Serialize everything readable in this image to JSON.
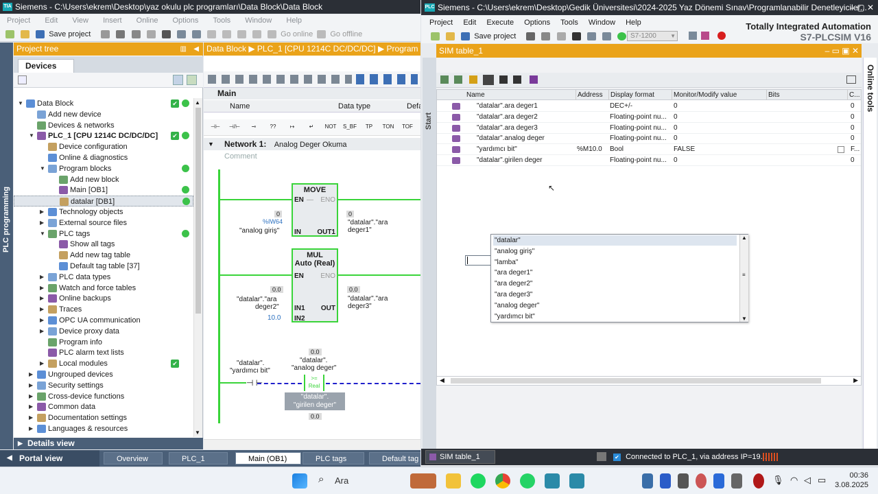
{
  "tia": {
    "title": "Siemens  -  C:\\Users\\ekrem\\Desktop\\yaz okulu plc programları\\Data Block\\Data Block",
    "menu": [
      "Project",
      "Edit",
      "View",
      "Insert",
      "Online",
      "Options",
      "Tools",
      "Window",
      "Help"
    ],
    "toolbar": {
      "save": "Save project",
      "go_online": "Go online",
      "go_offline": "Go offline"
    },
    "sidebar_label": "PLC programming",
    "project_tree": {
      "title": "Project tree",
      "devices_tab": "Devices",
      "items": [
        {
          "label": "Data Block",
          "lvl": 0,
          "arrow": "▼",
          "status": "check-dot"
        },
        {
          "label": "Add new device",
          "lvl": 1,
          "arrow": ""
        },
        {
          "label": "Devices & networks",
          "lvl": 1,
          "arrow": ""
        },
        {
          "label": "PLC_1 [CPU 1214C DC/DC/DC]",
          "lvl": 1,
          "arrow": "▼",
          "status": "check-dot",
          "bold": true
        },
        {
          "label": "Device configuration",
          "lvl": 2,
          "arrow": ""
        },
        {
          "label": "Online & diagnostics",
          "lvl": 2,
          "arrow": ""
        },
        {
          "label": "Program blocks",
          "lvl": 2,
          "arrow": "▼",
          "status": "dot"
        },
        {
          "label": "Add new block",
          "lvl": 3,
          "arrow": ""
        },
        {
          "label": "Main [OB1]",
          "lvl": 3,
          "arrow": "",
          "status": "dot"
        },
        {
          "label": "datalar [DB1]",
          "lvl": 3,
          "arrow": "",
          "status": "dot",
          "selected": true
        },
        {
          "label": "Technology objects",
          "lvl": 2,
          "arrow": "▶"
        },
        {
          "label": "External source files",
          "lvl": 2,
          "arrow": "▶"
        },
        {
          "label": "PLC tags",
          "lvl": 2,
          "arrow": "▼",
          "status": "dot"
        },
        {
          "label": "Show all tags",
          "lvl": 3,
          "arrow": ""
        },
        {
          "label": "Add new tag table",
          "lvl": 3,
          "arrow": ""
        },
        {
          "label": "Default tag table [37]",
          "lvl": 3,
          "arrow": ""
        },
        {
          "label": "PLC data types",
          "lvl": 2,
          "arrow": "▶"
        },
        {
          "label": "Watch and force tables",
          "lvl": 2,
          "arrow": "▶"
        },
        {
          "label": "Online backups",
          "lvl": 2,
          "arrow": "▶"
        },
        {
          "label": "Traces",
          "lvl": 2,
          "arrow": "▶"
        },
        {
          "label": "OPC UA communication",
          "lvl": 2,
          "arrow": "▶"
        },
        {
          "label": "Device proxy data",
          "lvl": 2,
          "arrow": "▶"
        },
        {
          "label": "Program info",
          "lvl": 2,
          "arrow": ""
        },
        {
          "label": "PLC alarm text lists",
          "lvl": 2,
          "arrow": ""
        },
        {
          "label": "Local modules",
          "lvl": 2,
          "arrow": "▶",
          "status": "check"
        },
        {
          "label": "Ungrouped devices",
          "lvl": 1,
          "arrow": "▶"
        },
        {
          "label": "Security settings",
          "lvl": 1,
          "arrow": "▶"
        },
        {
          "label": "Cross-device functions",
          "lvl": 1,
          "arrow": "▶"
        },
        {
          "label": "Common data",
          "lvl": 1,
          "arrow": "▶"
        },
        {
          "label": "Documentation settings",
          "lvl": 1,
          "arrow": "▶"
        },
        {
          "label": "Languages & resources",
          "lvl": 1,
          "arrow": "▶"
        }
      ]
    },
    "details_view": "Details view",
    "editor": {
      "breadcrumb": "Data Block  ▶  PLC_1 [CPU 1214C DC/DC/DC]  ▶  Program bl",
      "main_label": "Main",
      "col_name": "Name",
      "col_type": "Data type",
      "col_default": "Defa",
      "ladder_items": [
        "⊣⊢",
        "⊣/⊢",
        "⊸",
        "??",
        "↦",
        "↵",
        "NOT",
        "S_BF",
        "TP",
        "TON",
        "TOF"
      ],
      "network_title": "Network 1:",
      "network_sub": "Analog Deger Okuma",
      "comment": "Comment",
      "move": {
        "title": "MOVE",
        "en": "EN",
        "eno": "ENO",
        "in": "IN",
        "out": "OUT1",
        "in_val": "0",
        "in_addr": "%IW64",
        "in_tag": "\"analog giriş\"",
        "out_val": "0",
        "out_tag1": "\"datalar\".\"ara",
        "out_tag2": "deger1\""
      },
      "mul": {
        "title": "MUL",
        "subtitle": "Auto (Real)",
        "en": "EN",
        "eno": "ENO",
        "in1": "IN1",
        "in2": "IN2",
        "out": "OUT",
        "in1_val": "0.0",
        "in1_tag1": "\"datalar\".\"ara",
        "in1_tag2": "deger2\"",
        "in2_val": "10.0",
        "out_val": "0.0",
        "out_tag1": "\"datalar\".\"ara",
        "out_tag2": "deger3\""
      },
      "net2": {
        "contact_tag1": "\"datalar\".",
        "contact_tag2": "\"yardımcı bit\"",
        "cmp_val": "0.0",
        "cmp_tag1": "\"datalar\".",
        "cmp_tag2": "\"analog deger\"",
        "cmp_op": ">=",
        "cmp_type": "Real",
        "cmp2_tag1": "\"datalar\".",
        "cmp2_tag2": "\"girilen deger\"",
        "cmp2_val": "0.0"
      }
    },
    "portal": {
      "label": "Portal view",
      "tabs": [
        "Overview",
        "PLC_1",
        "Main (OB1)",
        "PLC tags",
        "Default tag t..."
      ]
    }
  },
  "sim": {
    "title": "Siemens  -  C:\\Users\\ekrem\\Desktop\\Gedik Üniversitesi\\2024-2025 Yaz Dönemi Sınav\\Programlanabilir Denetleyiciler...",
    "menu": [
      "Project",
      "Edit",
      "Execute",
      "Options",
      "Tools",
      "Window",
      "Help"
    ],
    "save": "Save project",
    "cpu": "S7-1200",
    "brand1": "Totally Integrated Automation",
    "brand2": "S7-PLCSIM V16",
    "start": "Start",
    "online_tools": "Online tools",
    "table_title": "SIM table_1",
    "columns": [
      "Name",
      "Address",
      "Display format",
      "Monitor/Modify value",
      "Bits",
      "C..."
    ],
    "rows": [
      {
        "name": "\"datalar\".ara deger1",
        "addr": "",
        "fmt": "DEC+/-",
        "val": "0",
        "c": "0"
      },
      {
        "name": "\"datalar\".ara deger2",
        "addr": "",
        "fmt": "Floating-point nu...",
        "val": "0",
        "c": "0"
      },
      {
        "name": "\"datalar\".ara deger3",
        "addr": "",
        "fmt": "Floating-point nu...",
        "val": "0",
        "c": "0"
      },
      {
        "name": "\"datalar\".analog deger",
        "addr": "",
        "fmt": "Floating-point nu...",
        "val": "0",
        "c": "0"
      },
      {
        "name": "\"yardımcı bit\"",
        "addr": "%M10.0",
        "fmt": "Bool",
        "val": "FALSE",
        "c": "F..."
      },
      {
        "name": "\"datalar\".girilen deger",
        "addr": "",
        "fmt": "Floating-point nu...",
        "val": "0",
        "c": "0"
      }
    ],
    "dropdown": [
      "\"datalar\"",
      "\"analog giriş\"",
      "\"lamba\"",
      "\"ara deger1\"",
      "\"ara deger2\"",
      "\"ara deger3\"",
      "\"analog deger\"",
      "\"yardımcı bit\""
    ],
    "status_tab": "SIM table_1",
    "status": "Connected to PLC_1, via address IP=19..."
  },
  "taskbar": {
    "search": "Ara",
    "time": "00:36",
    "date": "3.08.2025"
  },
  "colors": {
    "accent": "#eaa31a",
    "title_bar": "#2b2f36",
    "portal": "#4a5f78",
    "ladder_green": "#39d439"
  }
}
